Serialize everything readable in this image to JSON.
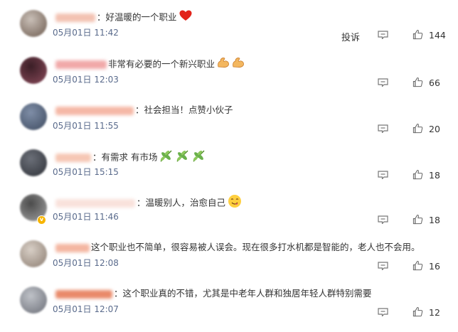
{
  "comments": [
    {
      "text": "：好温暖的一个职业",
      "time": "05月01日 11:42",
      "likes": "144",
      "emojis": [
        "heart"
      ],
      "avatar_colors": [
        "#c9bfb7",
        "#6d5b4f"
      ],
      "name_color": "#f3c2b2",
      "verified": false,
      "report": "投诉"
    },
    {
      "text": "非常有必要的一个新兴职业",
      "time": "05月01日 12:03",
      "likes": "66",
      "emojis": [
        "flexed-biceps",
        "flexed-biceps"
      ],
      "avatar_colors": [
        "#3a1e26",
        "#8a4a5a"
      ],
      "name_color": "#f1a9a9",
      "verified": false
    },
    {
      "text": "：社会担当！点赞小伙子",
      "time": "05月01日 11:55",
      "likes": "20",
      "emojis": [],
      "avatar_colors": [
        "#7f8ea7",
        "#3d4a5f"
      ],
      "name_color": "#f5b8a6",
      "verified": false
    },
    {
      "text": "：有需求 有市场",
      "time": "05月01日 15:15",
      "likes": "18",
      "emojis": [
        "herb",
        "herb",
        "herb"
      ],
      "avatar_colors": [
        "#6b6f78",
        "#2e3138"
      ],
      "name_color": "#f6c7b4",
      "verified": false
    },
    {
      "text": "：温暖别人，治愈自己",
      "time": "05月01日 11:46",
      "likes": "18",
      "emojis": [
        "face-savoring"
      ],
      "avatar_colors": [
        "#4b4b4b",
        "#a3a3a3"
      ],
      "name_color": "#f9e2dc",
      "verified": true
    },
    {
      "text": "这个职业也不简单，很容易被人误会。现在很多打水机都是智能的，老人也不会用。",
      "time": "05月01日 12:08",
      "likes": "16",
      "emojis": [],
      "avatar_colors": [
        "#d8cfc6",
        "#8b7c70"
      ],
      "name_color": "#f4b6a1",
      "verified": false
    },
    {
      "text": "：这个职业真的不错，尤其是中老年人群和独居年轻人群特别需要",
      "time": "05月01日 12:07",
      "likes": "12",
      "emojis": [],
      "avatar_colors": [
        "#bfc2c8",
        "#6b6e77"
      ],
      "name_color": "#e98a6a",
      "verified": false
    }
  ]
}
